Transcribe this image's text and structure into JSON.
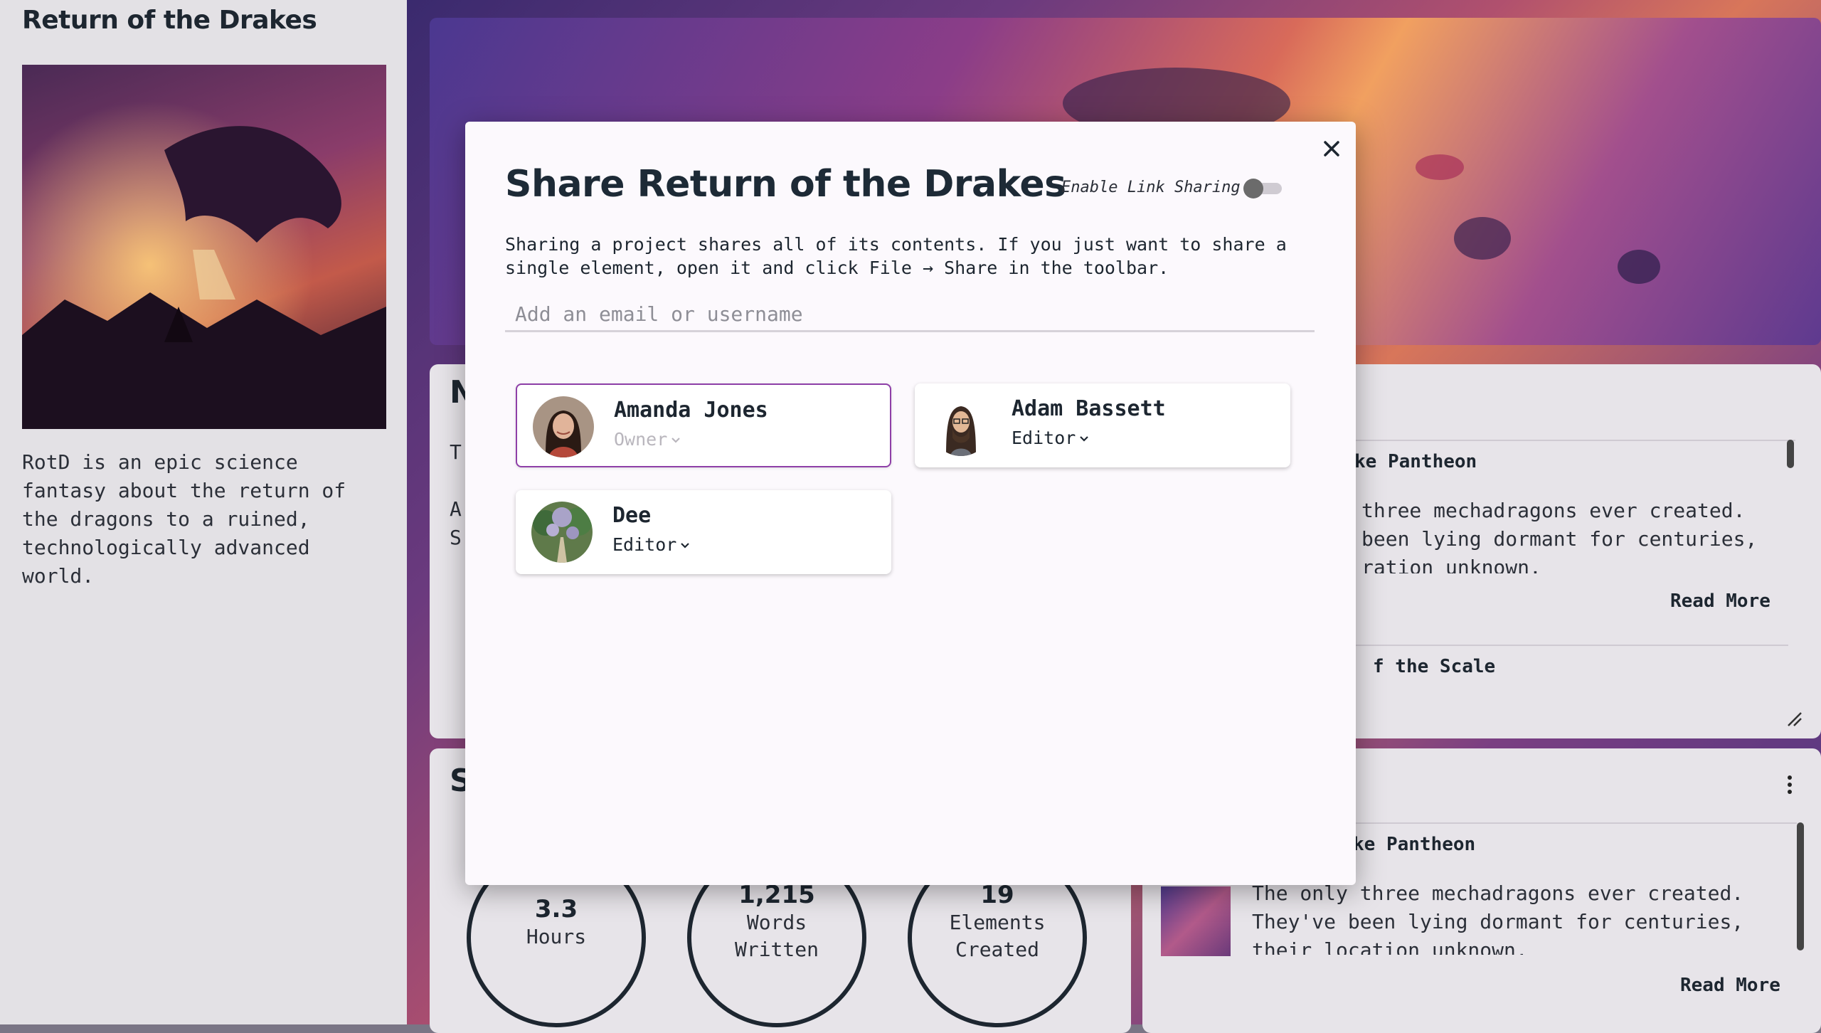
{
  "project": {
    "title": "Return of the Drakes",
    "description": "RotD is an epic science fantasy about the return of the dragons to a ruined, technologically advanced world."
  },
  "background": {
    "notes_heading_fragment": "N",
    "notes_text_1": "T",
    "notes_text_2": "A",
    "notes_text_3": "S",
    "notes_item_1_title": "ke Pantheon",
    "notes_item_1_text_1": "three mechadragons ever created.",
    "notes_item_1_text_2": "been lying dormant for centuries,",
    "notes_item_1_text_3": "ration unknown.",
    "notes_read_more": "Read More",
    "notes_item_2_title": "f the Scale",
    "stats_heading_fragment": "S",
    "stats": [
      {
        "value": "3.3",
        "label_1": "Hours",
        "label_2": ""
      },
      {
        "value": "1,215",
        "label_1": "Words",
        "label_2": "Written"
      },
      {
        "value": "19",
        "label_1": "Elements",
        "label_2": "Created"
      }
    ],
    "feed_item_title": "ke Pantheon",
    "feed_item_text_1": "The only three mechadragons ever created.",
    "feed_item_text_2": "They've been lying dormant for centuries,",
    "feed_item_text_3": "their location unknown.",
    "feed_read_more": "Read More"
  },
  "share_dialog": {
    "title": "Share Return of the Drakes",
    "link_sharing_label": "Enable Link Sharing",
    "link_sharing_enabled": false,
    "description": "Sharing a project shares all of its contents. If you just want to share a single element, open it and click File → Share in the toolbar.",
    "input_placeholder": "Add an email or username",
    "input_value": "",
    "collaborators": [
      {
        "name": "Amanda Jones",
        "role": "Owner",
        "avatar": "woman-portrait"
      },
      {
        "name": "Adam Bassett",
        "role": "Editor",
        "avatar": "bearded-man-illustration"
      },
      {
        "name": "Dee",
        "role": "Editor",
        "avatar": "garden-path-photo"
      }
    ]
  },
  "icons": {
    "close": "close-icon",
    "chevron": "chevron-down-icon",
    "more": "more-vertical-icon",
    "resize": "resize-handle-icon"
  },
  "colors": {
    "owner_border": "#8e3fa8",
    "modal_bg": "#fcf9fd",
    "toggle_knob": "#6b6b6b"
  }
}
